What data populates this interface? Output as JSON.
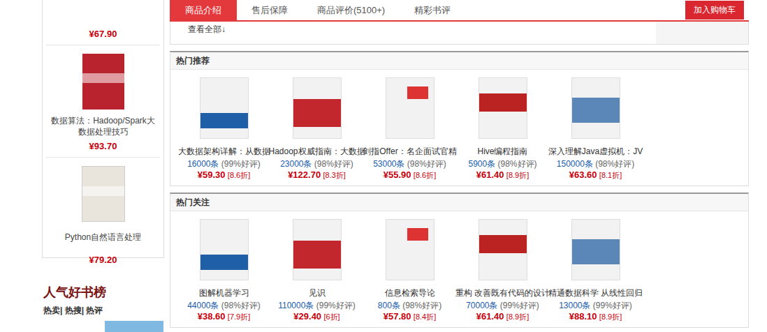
{
  "tabs": [
    {
      "label": "商品介绍",
      "selected": true
    },
    {
      "label": "售后保障",
      "selected": false
    },
    {
      "label": "商品评价(5100+)",
      "selected": false
    },
    {
      "label": "精彩书评",
      "selected": false
    }
  ],
  "cart_button": "加入购物车",
  "more_link": "查看全部↓",
  "sidebar": {
    "partial_price": "¥67.90",
    "books": [
      {
        "title": "数据算法：Hadoop/Spark大数据处理技巧",
        "price": "¥93.70"
      },
      {
        "title": "Python自然语言处理",
        "price": "¥79.20"
      }
    ]
  },
  "rank": {
    "title": "人气好书榜",
    "tabs": [
      "热卖",
      "热搜",
      "热评"
    ],
    "separator": "|"
  },
  "sections": [
    {
      "title": "热门推荐",
      "items": [
        {
          "title": "大数据架构详解：从数据",
          "count": "16000条",
          "rating": "(99%好评)",
          "price": "¥59.30",
          "discount": "[8.6折]"
        },
        {
          "title": "Hadoop权威指南：大数据",
          "count": "23000条",
          "rating": "(98%好评)",
          "price": "¥122.70",
          "discount": "[8.3折]"
        },
        {
          "title": "剑指Offer：名企面试官精",
          "count": "53000条",
          "rating": "(98%好评)",
          "price": "¥55.90",
          "discount": "[8.6折]"
        },
        {
          "title": "Hive编程指南",
          "count": "5900条",
          "rating": "(98%好评)",
          "price": "¥61.40",
          "discount": "[8.9折]"
        },
        {
          "title": "深入理解Java虚拟机：JV",
          "count": "150000条",
          "rating": "(98%好评)",
          "price": "¥63.60",
          "discount": "[8.1折]"
        }
      ]
    },
    {
      "title": "热门关注",
      "items": [
        {
          "title": "图解机器学习",
          "count": "44000条",
          "rating": "(98%好评)",
          "price": "¥38.60",
          "discount": "[7.9折]"
        },
        {
          "title": "见识",
          "count": "110000条",
          "rating": "(99%好评)",
          "price": "¥29.40",
          "discount": "[6折]"
        },
        {
          "title": "信息检索导论",
          "count": "800条",
          "rating": "(98%好评)",
          "price": "¥57.80",
          "discount": "[8.4折]"
        },
        {
          "title": "重构 改善既有代码的设计",
          "count": "70000条",
          "rating": "(99%好评)",
          "price": "¥61.40",
          "discount": "[8.9折]"
        },
        {
          "title": "精通数据科学 从线性回归",
          "count": "13000条",
          "rating": "(99%好评)",
          "price": "¥88.10",
          "discount": "[8.9折]"
        }
      ]
    }
  ]
}
